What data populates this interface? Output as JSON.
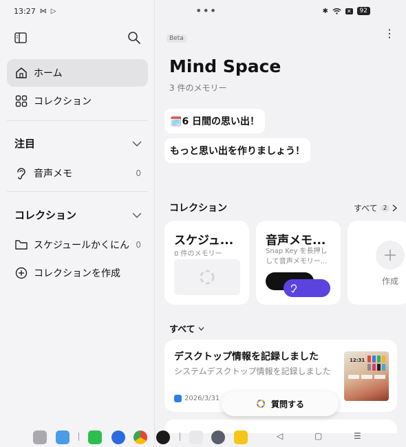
{
  "status_bar": {
    "time": "13:27",
    "battery": "92"
  },
  "sidebar": {
    "items": [
      {
        "label": "ホーム",
        "icon": "home-icon",
        "active": true
      },
      {
        "label": "コレクション",
        "icon": "grid-icon"
      }
    ],
    "sections": [
      {
        "title": "注目",
        "items": [
          {
            "label": "音声メモ",
            "count": "0",
            "icon": "ear-icon"
          }
        ]
      },
      {
        "title": "コレクション",
        "items": [
          {
            "label": "スケジュールかくにん",
            "count": "0",
            "icon": "folder-icon"
          },
          {
            "label": "コレクションを作成",
            "icon": "plus-circle-icon"
          }
        ]
      }
    ]
  },
  "main": {
    "beta": "Beta",
    "title": "Mind Space",
    "subtitle": "3 件のメモリー",
    "bubbles": [
      {
        "emoji": "🗓️",
        "text": "6 日間の思い出！"
      },
      {
        "text": "もっと思い出を作りましょう！"
      }
    ],
    "collections": {
      "heading": "コレクション",
      "see_all": "すべて",
      "see_all_count": "2",
      "cards": [
        {
          "title": "スケジュ...",
          "subtitle": "0 件のメモリー"
        },
        {
          "title": "音声メモ...",
          "subtitle_line1": "Snap Key を長押し",
          "subtitle_line2": "して音声メモリー..."
        },
        {
          "label": "作成"
        }
      ]
    },
    "filter": "すべて",
    "memory": {
      "title": "デスクトップ情報を記録しました",
      "subtitle": "システムデスクトップ情報を記録しました",
      "date": "2026/3/31",
      "thumb_time": "12:31"
    },
    "ask_button": "質問する"
  },
  "colors": {
    "accent_purple": "#5b43e0",
    "background": "#f2f2f4"
  }
}
